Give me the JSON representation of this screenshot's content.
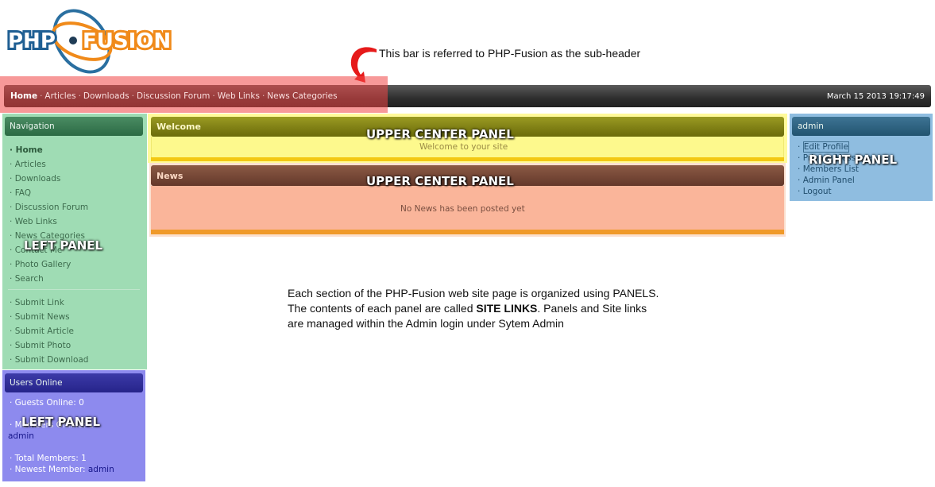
{
  "logo": {
    "text_left": "PHP",
    "text_right": "FUSION"
  },
  "annotation": {
    "text": "This bar is referred to PHP-Fusion as the sub-header"
  },
  "subheader": {
    "links": [
      "Home",
      "Articles",
      "Downloads",
      "Discussion Forum",
      "Web Links",
      "News Categories"
    ],
    "separator": "·",
    "date": "March 15 2013 19:17:49"
  },
  "left_panel": {
    "title": "Navigation",
    "items": [
      "Home",
      "Articles",
      "Downloads",
      "FAQ",
      "Discussion Forum",
      "Web Links",
      "News Categories",
      "Contact Me",
      "Photo Gallery",
      "Search"
    ],
    "submit_items": [
      "Submit Link",
      "Submit News",
      "Submit Article",
      "Submit Photo",
      "Submit Download"
    ],
    "label": "LEFT PANEL"
  },
  "users_online": {
    "title": "Users Online",
    "guests": "· Guests Online: 0",
    "members": "· Members Online: 1",
    "member_name": "admin",
    "total_members": "· Total Members: 1",
    "newest_member_prefix": "· Newest Member:",
    "newest_member": "admin",
    "label": "LEFT PANEL"
  },
  "center": {
    "welcome_title": "Welcome",
    "welcome_text": "Welcome to your site",
    "news_title": "News",
    "news_text": "No News has been posted yet",
    "label_1": "UPPER CENTER PANEL",
    "label_2": "UPPER CENTER PANEL"
  },
  "right_panel": {
    "title": "admin",
    "items": [
      "Edit Profile",
      "Private Messages",
      "Members List",
      "Admin Panel",
      "Logout"
    ],
    "label": "RIGHT PANEL"
  },
  "description": {
    "line1": "Each section of the PHP-Fusion web site page is organized using PANELS.",
    "line2_pre": "The contents of each panel are called",
    "line2_bold": "SITE LINKS",
    "line2_post": ".  Panels and Site links",
    "line3": "are managed within the Admin login under Sytem Admin"
  },
  "colors": {
    "subheader_highlight": "#f04646",
    "left_panel": "#9fdcb4",
    "users_panel": "#8d8aee",
    "welcome_body": "#fdf98d",
    "news_body": "#fab59a",
    "right_panel": "#8fbde0",
    "arrow": "#e61a1a"
  }
}
